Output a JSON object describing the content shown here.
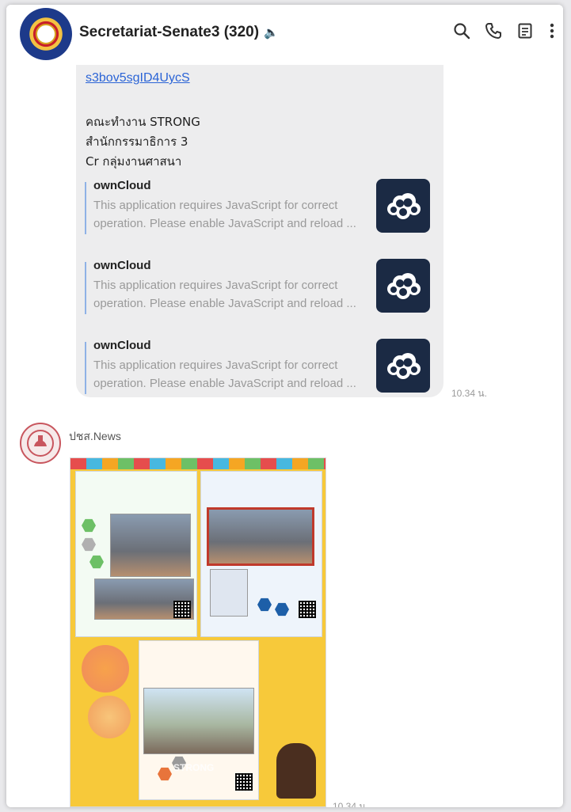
{
  "header": {
    "title": "Secretariat-Senate3 (320)",
    "mute_icon": "speaker-muted-icon",
    "actions": [
      "search-icon",
      "phone-icon",
      "notes-icon",
      "more-vertical-icon"
    ]
  },
  "message1": {
    "link": "s3bov5sgID4UycS",
    "lines": [
      "คณะทำงาน STRONG",
      "สำนักกรรมาธิการ 3",
      "Cr กลุ่มงานศาสนา"
    ],
    "cards": [
      {
        "title": "ownCloud",
        "desc": "This application requires JavaScript for correct operation. Please enable JavaScript and reload ...",
        "icon": "owncloud-logo-icon"
      },
      {
        "title": "ownCloud",
        "desc": "This application requires JavaScript for correct operation. Please enable JavaScript and reload ...",
        "icon": "owncloud-logo-icon"
      },
      {
        "title": "ownCloud",
        "desc": "This application requires JavaScript for correct operation. Please enable JavaScript and reload ...",
        "icon": "owncloud-logo-icon"
      }
    ],
    "time": "10.34 น."
  },
  "message2": {
    "sender": "ปชส.News",
    "poster_word": "STRONG",
    "time": "10.34 น."
  }
}
